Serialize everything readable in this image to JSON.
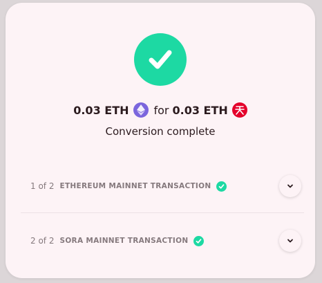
{
  "summary": {
    "from_amount": "0.03 ETH",
    "from_token_icon": "ethereum-icon",
    "connector": "for",
    "to_amount": "0.03 ETH",
    "to_token_icon": "sora-icon",
    "status": "Conversion complete",
    "status_icon": "success-check-icon"
  },
  "steps": [
    {
      "counter": "1 of 2",
      "title": "ETHEREUM MAINNET TRANSACTION",
      "state_icon": "check-circle-icon"
    },
    {
      "counter": "2 of 2",
      "title": "SORA MAINNET TRANSACTION",
      "state_icon": "check-circle-icon"
    }
  ],
  "colors": {
    "accent_success": "#1dd9a3",
    "ethereum": "#7b66dd",
    "sora": "#e4002b",
    "card_background": "#fdf3f6"
  }
}
